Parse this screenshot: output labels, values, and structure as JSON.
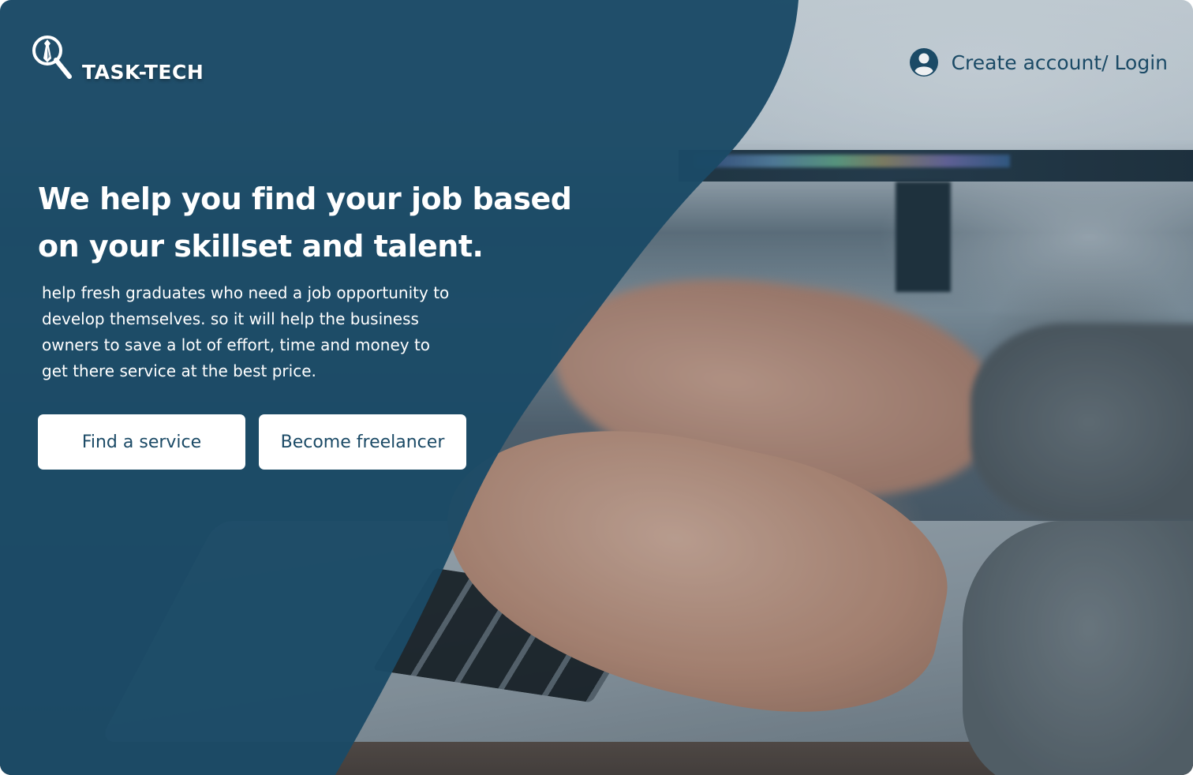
{
  "brand": {
    "name": "TASK-TECH",
    "logo_icon": "magnifier-tie-icon"
  },
  "header": {
    "account_link": "Create account/ Login",
    "account_icon": "user-circle-icon"
  },
  "hero": {
    "headline_line1": "We help you find your job based",
    "headline_line2": "on your skillset and talent.",
    "description_lines": [
      "help fresh graduates who need a job opportunity to",
      "develop themselves. so it will help the business",
      "owners to save a lot of effort, time and money to",
      "get there service at the best price."
    ],
    "buttons": {
      "find_service": "Find a service",
      "become_freelancer": "Become freelancer"
    }
  },
  "colors": {
    "panel": "#1b4a66",
    "accent_text": "#1b4a66",
    "button_bg": "#ffffff"
  }
}
